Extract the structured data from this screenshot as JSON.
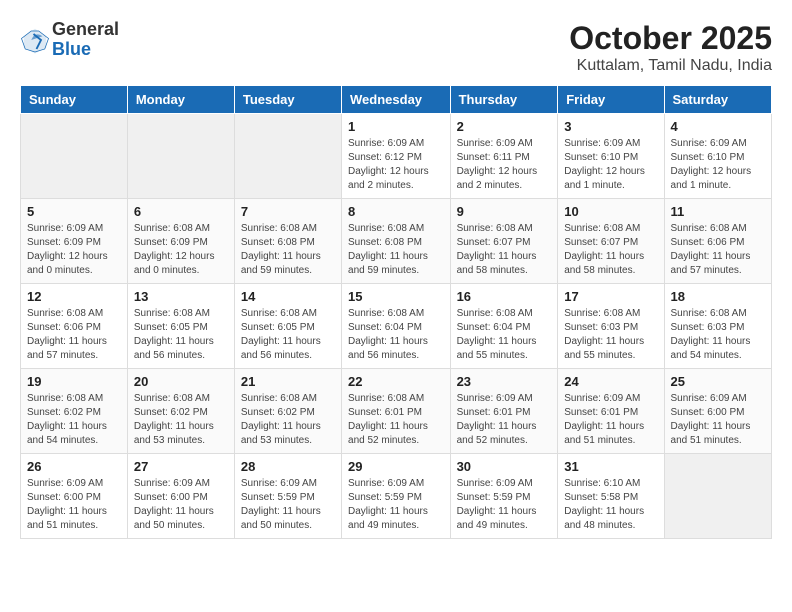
{
  "header": {
    "logo_general": "General",
    "logo_blue": "Blue",
    "month_title": "October 2025",
    "location": "Kuttalam, Tamil Nadu, India"
  },
  "days_of_week": [
    "Sunday",
    "Monday",
    "Tuesday",
    "Wednesday",
    "Thursday",
    "Friday",
    "Saturday"
  ],
  "weeks": [
    [
      {
        "day": "",
        "empty": true
      },
      {
        "day": "",
        "empty": true
      },
      {
        "day": "",
        "empty": true
      },
      {
        "day": "1",
        "sunrise": "6:09 AM",
        "sunset": "6:12 PM",
        "daylight": "12 hours and 2 minutes."
      },
      {
        "day": "2",
        "sunrise": "6:09 AM",
        "sunset": "6:11 PM",
        "daylight": "12 hours and 2 minutes."
      },
      {
        "day": "3",
        "sunrise": "6:09 AM",
        "sunset": "6:10 PM",
        "daylight": "12 hours and 1 minute."
      },
      {
        "day": "4",
        "sunrise": "6:09 AM",
        "sunset": "6:10 PM",
        "daylight": "12 hours and 1 minute."
      }
    ],
    [
      {
        "day": "5",
        "sunrise": "6:09 AM",
        "sunset": "6:09 PM",
        "daylight": "12 hours and 0 minutes."
      },
      {
        "day": "6",
        "sunrise": "6:08 AM",
        "sunset": "6:09 PM",
        "daylight": "12 hours and 0 minutes."
      },
      {
        "day": "7",
        "sunrise": "6:08 AM",
        "sunset": "6:08 PM",
        "daylight": "11 hours and 59 minutes."
      },
      {
        "day": "8",
        "sunrise": "6:08 AM",
        "sunset": "6:08 PM",
        "daylight": "11 hours and 59 minutes."
      },
      {
        "day": "9",
        "sunrise": "6:08 AM",
        "sunset": "6:07 PM",
        "daylight": "11 hours and 58 minutes."
      },
      {
        "day": "10",
        "sunrise": "6:08 AM",
        "sunset": "6:07 PM",
        "daylight": "11 hours and 58 minutes."
      },
      {
        "day": "11",
        "sunrise": "6:08 AM",
        "sunset": "6:06 PM",
        "daylight": "11 hours and 57 minutes."
      }
    ],
    [
      {
        "day": "12",
        "sunrise": "6:08 AM",
        "sunset": "6:06 PM",
        "daylight": "11 hours and 57 minutes."
      },
      {
        "day": "13",
        "sunrise": "6:08 AM",
        "sunset": "6:05 PM",
        "daylight": "11 hours and 56 minutes."
      },
      {
        "day": "14",
        "sunrise": "6:08 AM",
        "sunset": "6:05 PM",
        "daylight": "11 hours and 56 minutes."
      },
      {
        "day": "15",
        "sunrise": "6:08 AM",
        "sunset": "6:04 PM",
        "daylight": "11 hours and 56 minutes."
      },
      {
        "day": "16",
        "sunrise": "6:08 AM",
        "sunset": "6:04 PM",
        "daylight": "11 hours and 55 minutes."
      },
      {
        "day": "17",
        "sunrise": "6:08 AM",
        "sunset": "6:03 PM",
        "daylight": "11 hours and 55 minutes."
      },
      {
        "day": "18",
        "sunrise": "6:08 AM",
        "sunset": "6:03 PM",
        "daylight": "11 hours and 54 minutes."
      }
    ],
    [
      {
        "day": "19",
        "sunrise": "6:08 AM",
        "sunset": "6:02 PM",
        "daylight": "11 hours and 54 minutes."
      },
      {
        "day": "20",
        "sunrise": "6:08 AM",
        "sunset": "6:02 PM",
        "daylight": "11 hours and 53 minutes."
      },
      {
        "day": "21",
        "sunrise": "6:08 AM",
        "sunset": "6:02 PM",
        "daylight": "11 hours and 53 minutes."
      },
      {
        "day": "22",
        "sunrise": "6:08 AM",
        "sunset": "6:01 PM",
        "daylight": "11 hours and 52 minutes."
      },
      {
        "day": "23",
        "sunrise": "6:09 AM",
        "sunset": "6:01 PM",
        "daylight": "11 hours and 52 minutes."
      },
      {
        "day": "24",
        "sunrise": "6:09 AM",
        "sunset": "6:01 PM",
        "daylight": "11 hours and 51 minutes."
      },
      {
        "day": "25",
        "sunrise": "6:09 AM",
        "sunset": "6:00 PM",
        "daylight": "11 hours and 51 minutes."
      }
    ],
    [
      {
        "day": "26",
        "sunrise": "6:09 AM",
        "sunset": "6:00 PM",
        "daylight": "11 hours and 51 minutes."
      },
      {
        "day": "27",
        "sunrise": "6:09 AM",
        "sunset": "6:00 PM",
        "daylight": "11 hours and 50 minutes."
      },
      {
        "day": "28",
        "sunrise": "6:09 AM",
        "sunset": "5:59 PM",
        "daylight": "11 hours and 50 minutes."
      },
      {
        "day": "29",
        "sunrise": "6:09 AM",
        "sunset": "5:59 PM",
        "daylight": "11 hours and 49 minutes."
      },
      {
        "day": "30",
        "sunrise": "6:09 AM",
        "sunset": "5:59 PM",
        "daylight": "11 hours and 49 minutes."
      },
      {
        "day": "31",
        "sunrise": "6:10 AM",
        "sunset": "5:58 PM",
        "daylight": "11 hours and 48 minutes."
      },
      {
        "day": "",
        "empty": true
      }
    ]
  ],
  "labels": {
    "sunrise": "Sunrise:",
    "sunset": "Sunset:",
    "daylight": "Daylight hours"
  }
}
